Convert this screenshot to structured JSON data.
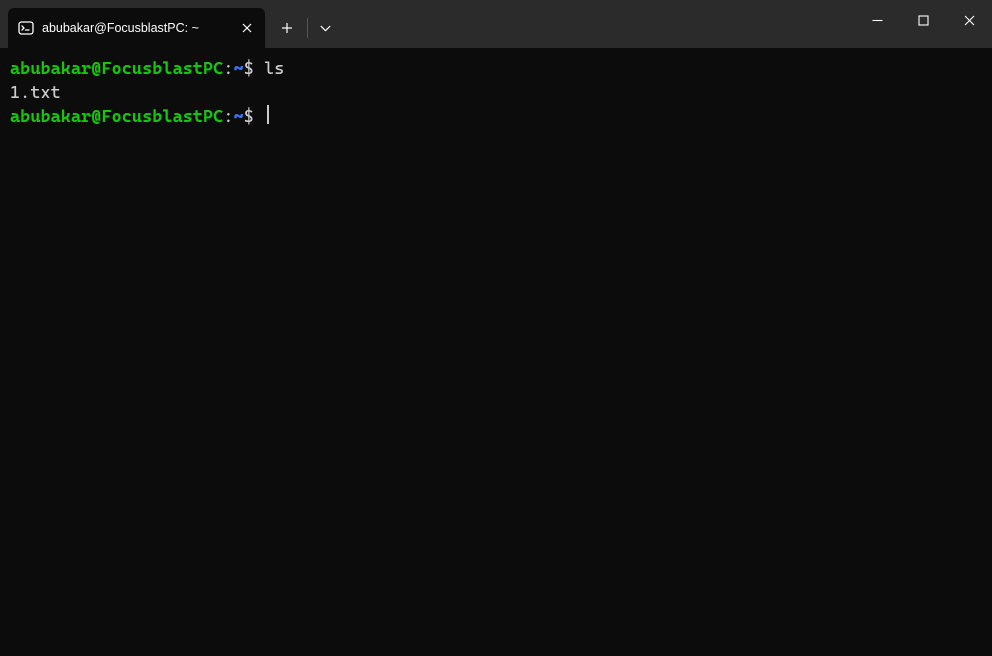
{
  "titlebar": {
    "tab": {
      "title": "abubakar@FocusblastPC: ~"
    }
  },
  "terminal": {
    "lines": [
      {
        "type": "prompt",
        "user_host": "abubakar@FocusblastPC",
        "path": "~",
        "command": "ls"
      },
      {
        "type": "output",
        "text": "1.txt"
      },
      {
        "type": "prompt",
        "user_host": "abubakar@FocusblastPC",
        "path": "~",
        "command": ""
      }
    ]
  },
  "colors": {
    "bg": "#0c0c0c",
    "titlebar": "#2b2b2b",
    "prompt_user": "#16c60c",
    "prompt_path": "#3b78ff",
    "text": "#cccccc"
  }
}
